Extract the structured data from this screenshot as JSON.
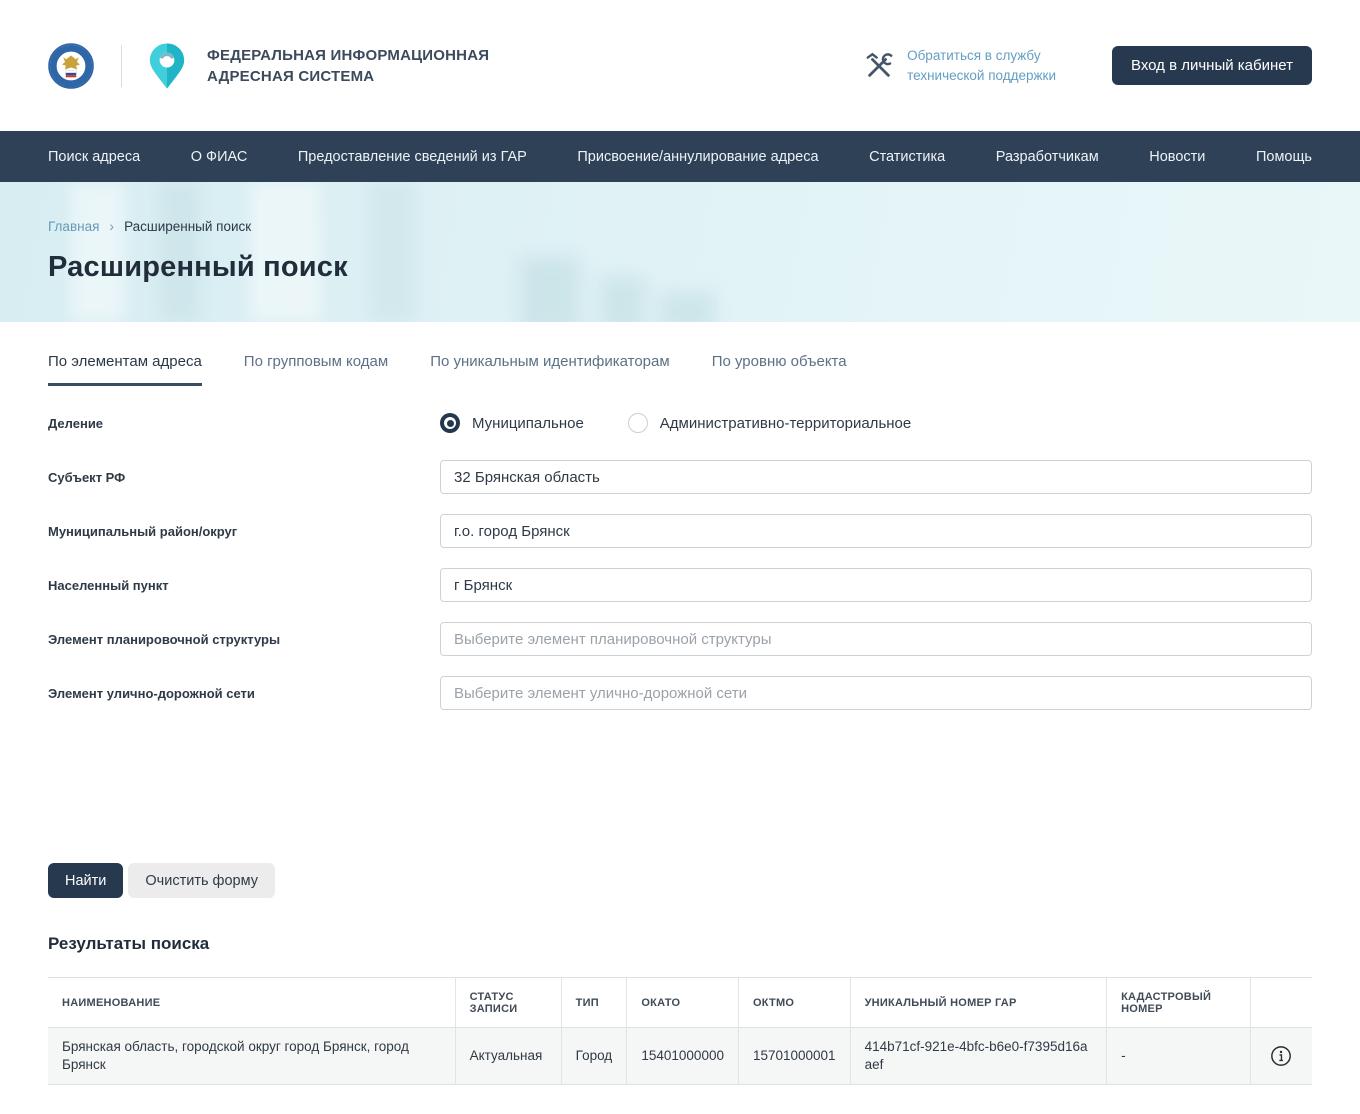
{
  "header": {
    "org_title_line1": "ФЕДЕРАЛЬНАЯ ИНФОРМАЦИОННАЯ",
    "org_title_line2": "АДРЕСНАЯ СИСТЕМА",
    "support_line1": "Обратиться в службу",
    "support_line2": "технической поддержки",
    "login_button": "Вход в личный кабинет"
  },
  "nav": {
    "items": [
      "Поиск адреса",
      "О ФИАС",
      "Предоставление сведений из ГАР",
      "Присвоение/аннулирование адреса",
      "Статистика",
      "Разработчикам",
      "Новости",
      "Помощь"
    ]
  },
  "breadcrumb": {
    "home": "Главная",
    "separator": "›",
    "current": "Расширенный поиск"
  },
  "page": {
    "title": "Расширенный поиск"
  },
  "tabs": [
    {
      "label": "По элементам адреса",
      "active": true
    },
    {
      "label": "По групповым кодам",
      "active": false
    },
    {
      "label": "По уникальным идентификаторам",
      "active": false
    },
    {
      "label": "По уровню объекта",
      "active": false
    }
  ],
  "form": {
    "division_label": "Деление",
    "division_options": [
      {
        "label": "Муниципальное",
        "selected": true
      },
      {
        "label": "Административно-территориальное",
        "selected": false
      }
    ],
    "fields": [
      {
        "label": "Субъект РФ",
        "value": "32 Брянская область",
        "placeholder": ""
      },
      {
        "label": "Муниципальный район/округ",
        "value": "г.о. город Брянск",
        "placeholder": ""
      },
      {
        "label": "Населенный пункт",
        "value": "г Брянск",
        "placeholder": ""
      },
      {
        "label": "Элемент планировочной структуры",
        "value": "",
        "placeholder": "Выберите элемент планировочной структуры"
      },
      {
        "label": "Элемент улично-дорожной сети",
        "value": "",
        "placeholder": "Выберите элемент улично-дорожной сети"
      }
    ],
    "search_button": "Найти",
    "clear_button": "Очистить форму"
  },
  "results": {
    "title": "Результаты поиска",
    "columns": [
      "НАИМЕНОВАНИЕ",
      "СТАТУС ЗАПИСИ",
      "ТИП",
      "ОКАТО",
      "ОКТМО",
      "УНИКАЛЬНЫЙ НОМЕР ГАР",
      "КАДАСТРОВЫЙ НОМЕР",
      ""
    ],
    "rows": [
      {
        "name": "Брянская область, городской округ город Брянск, город Брянск",
        "status": "Актуальная",
        "type": "Город",
        "okato": "15401000000",
        "oktmo": "15701000001",
        "gar_id": "414b71cf-921e-4bfc-b6e0-f7395d16aaef",
        "cadastral": "-"
      }
    ]
  },
  "icons": {
    "fns_emblem": "fns-round-emblem",
    "pin": "teal-location-pin",
    "support": "hammer-wrench",
    "info": "info-circle"
  },
  "colors": {
    "nav_bg": "#2e4156",
    "button_primary": "#27394e",
    "banner_bg": "#ddeff4",
    "link_blue": "#6699b8",
    "pin_teal_light": "#3ecfdb",
    "pin_teal_dark": "#1fb4c6",
    "row_bg": "#f5f6f6"
  }
}
